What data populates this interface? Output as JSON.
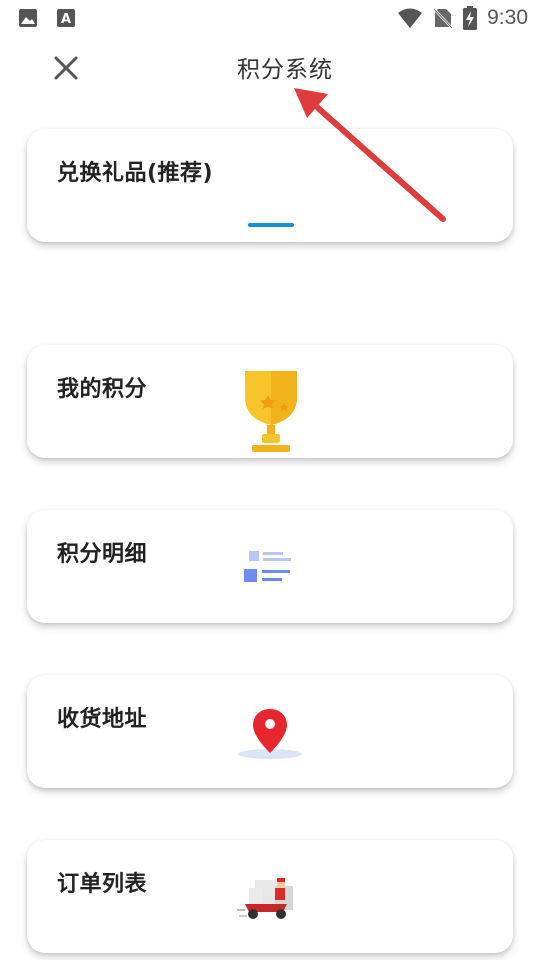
{
  "status_bar": {
    "time": "9:30",
    "icons": [
      "image-icon",
      "font-a-icon",
      "wifi-icon",
      "no-sim-icon",
      "battery-charging-icon"
    ]
  },
  "header": {
    "title": "积分系统",
    "close_icon": "close-icon"
  },
  "cards": [
    {
      "label": "兑换礼品(推荐)",
      "icon": "loading-bar-icon"
    },
    {
      "label": "我的积分",
      "icon": "trophy-icon"
    },
    {
      "label": "积分明细",
      "icon": "list-detail-icon"
    },
    {
      "label": "收货地址",
      "icon": "location-pin-icon"
    },
    {
      "label": "订单列表",
      "icon": "delivery-courier-icon"
    }
  ],
  "colors": {
    "annotation_arrow": "#e03c3c",
    "trophy": "#f7c52b",
    "list_icon": "#6d8ef0",
    "pin": "#e8262d",
    "progress_bar": "#1a8fd6"
  }
}
